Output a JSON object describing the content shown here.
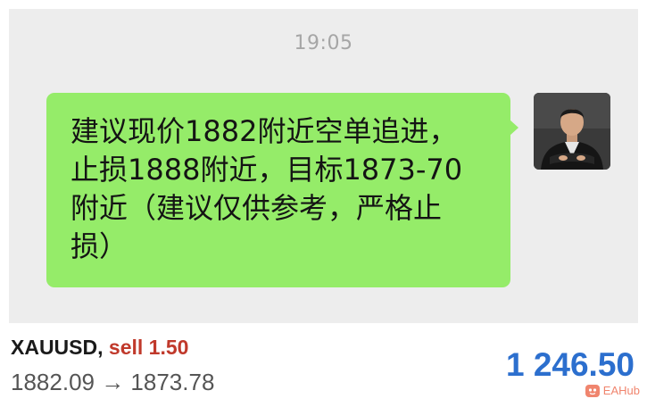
{
  "chat": {
    "timestamp": "19:05",
    "message": "建议现价1882附近空单追进，\n止损1888附近，目标1873-70\n附近（建议仅供参考，严格止\n损）",
    "bubble_color": "#95ec69",
    "avatar_icon": "avatar-photo"
  },
  "trade": {
    "symbol": "XAUUSD,",
    "side": "sell 1.50",
    "side_color": "#c0392b",
    "prices": "1882.09 → 1873.78",
    "profit": "1 246.50",
    "profit_color": "#2c6fce"
  },
  "watermark": {
    "text": "EAHub"
  }
}
